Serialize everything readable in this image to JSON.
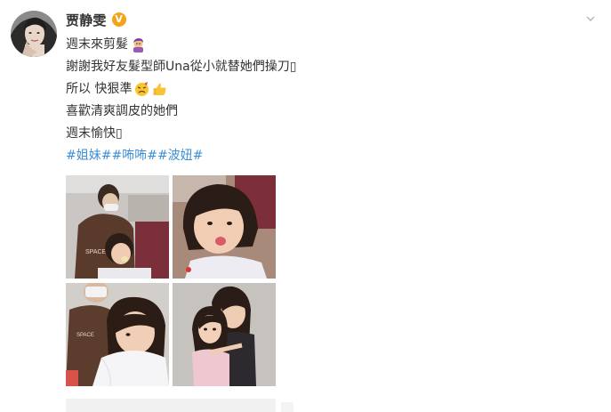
{
  "post": {
    "author": {
      "name": "贾静雯",
      "verified_badge": "V",
      "avatar_icon": "avatar-photo"
    },
    "more_icon": "chevron-down-icon",
    "lines": [
      "週末來剪髮",
      "謝謝我好友髮型師Una從小就替她們操刀▯",
      "所以 快狠準",
      "喜歡清爽調皮的她們",
      "週末愉快▯"
    ],
    "hashtags": [
      "#姐妹#",
      "#咘咘#",
      "#波妞#"
    ],
    "emojis": {
      "line1": "haircut-emoji",
      "line3_a": "strong-face-emoji",
      "line3_b": "thumbs-up-emoji"
    },
    "photos": [
      {
        "name": "photo-haircut-1",
        "icon": "photo"
      },
      {
        "name": "photo-haircut-2",
        "icon": "photo"
      },
      {
        "name": "photo-haircut-3",
        "icon": "photo"
      },
      {
        "name": "photo-sisters",
        "icon": "photo"
      }
    ],
    "colors": {
      "hashtag": "#3e8fd7",
      "badge": "#f7a21b",
      "text": "#333333"
    }
  }
}
